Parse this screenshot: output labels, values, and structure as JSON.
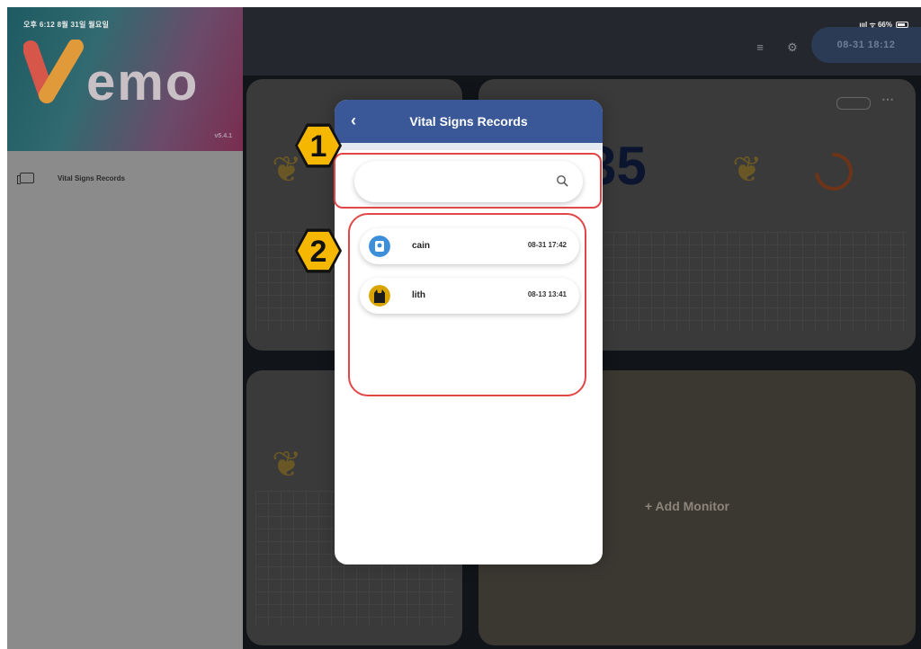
{
  "status_bar": {
    "time": "오후 6:12  8월 31일 월요일",
    "right": "ıııl ᯤ 66%"
  },
  "app": {
    "brand": "emo",
    "version": "v5.4.1",
    "header_time": "08-31 18:12",
    "big_value": "35",
    "add_monitor": "+  Add Monitor"
  },
  "sidebar": {
    "items": [
      {
        "label": "Vital Signs Records",
        "icon": "records-icon"
      }
    ]
  },
  "modal": {
    "title": "Vital Signs Records",
    "search": {
      "placeholder": "",
      "value": ""
    },
    "records": [
      {
        "name": "cain",
        "timestamp": "08-31 17:42",
        "avatar_color": "#3c8fd8"
      },
      {
        "name": "lith",
        "timestamp": "08-13 13:41",
        "avatar_color": "#d9a400"
      }
    ]
  },
  "callouts": [
    {
      "number": "1"
    },
    {
      "number": "2"
    }
  ],
  "colors": {
    "modal_header": "#3a5898",
    "callout": "#f5b700",
    "highlight": "#e04848"
  }
}
